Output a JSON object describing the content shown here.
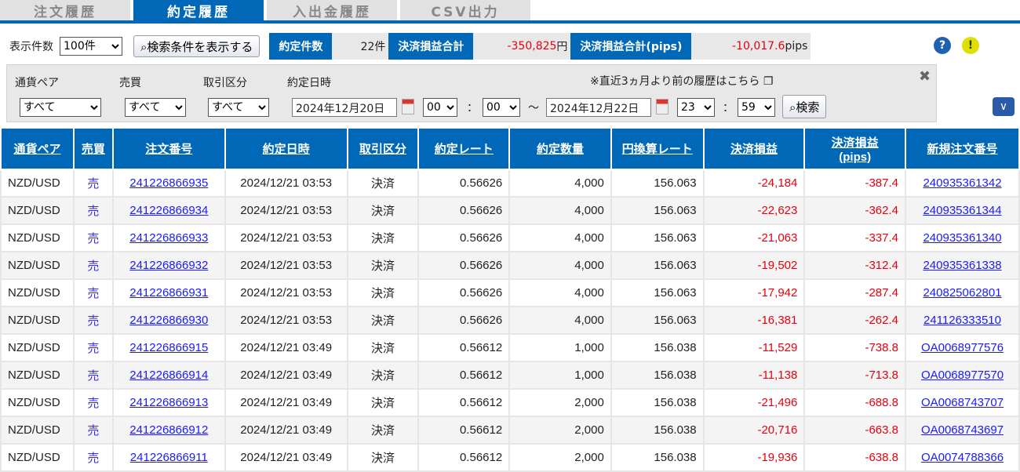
{
  "tabs": [
    "注文履歴",
    "約定履歴",
    "入出金履歴",
    "CSV出力"
  ],
  "summary": {
    "display_count_label": "表示件数",
    "display_count": "100件",
    "show_conditions": "検索条件を表示する",
    "count_label": "約定件数",
    "count": "22件",
    "pl_label": "決済損益合計",
    "pl_value": "-350,825",
    "pl_unit": "円",
    "pips_label": "決済損益合計(pips)",
    "pips_value": "-10,017.6",
    "pips_unit": "pips"
  },
  "filters": {
    "pair_label": "通貨ペア",
    "side_label": "売買",
    "type_label": "取引区分",
    "date_label": "約定日時",
    "pair": "すべて",
    "side": "すべて",
    "type": "すべて",
    "from_date": "2024年12月20日",
    "from_h": "00",
    "from_m": "00",
    "tilde": "～",
    "to_date": "2024年12月22日",
    "to_h": "23",
    "to_m": "59",
    "colon": "：",
    "search": "検索",
    "old_history": "※直近3ヵ月より前の履歴はこちら"
  },
  "headers": [
    "通貨ペア",
    "売買",
    "注文番号",
    "約定日時",
    "取引区分",
    "約定レート",
    "約定数量",
    "円換算レート",
    "決済損益",
    "決済損益\n(pips)",
    "新規注文番号"
  ],
  "rows": [
    [
      "NZD/USD",
      "売",
      "241226866935",
      "2024/12/21 03:53",
      "決済",
      "0.56626",
      "4,000",
      "156.063",
      "-24,184",
      "-387.4",
      "240935361342"
    ],
    [
      "NZD/USD",
      "売",
      "241226866934",
      "2024/12/21 03:53",
      "決済",
      "0.56626",
      "4,000",
      "156.063",
      "-22,623",
      "-362.4",
      "240935361344"
    ],
    [
      "NZD/USD",
      "売",
      "241226866933",
      "2024/12/21 03:53",
      "決済",
      "0.56626",
      "4,000",
      "156.063",
      "-21,063",
      "-337.4",
      "240935361340"
    ],
    [
      "NZD/USD",
      "売",
      "241226866932",
      "2024/12/21 03:53",
      "決済",
      "0.56626",
      "4,000",
      "156.063",
      "-19,502",
      "-312.4",
      "240935361338"
    ],
    [
      "NZD/USD",
      "売",
      "241226866931",
      "2024/12/21 03:53",
      "決済",
      "0.56626",
      "4,000",
      "156.063",
      "-17,942",
      "-287.4",
      "240825062801"
    ],
    [
      "NZD/USD",
      "売",
      "241226866930",
      "2024/12/21 03:53",
      "決済",
      "0.56626",
      "4,000",
      "156.063",
      "-16,381",
      "-262.4",
      "241126333510"
    ],
    [
      "NZD/USD",
      "売",
      "241226866915",
      "2024/12/21 03:49",
      "決済",
      "0.56612",
      "1,000",
      "156.038",
      "-11,529",
      "-738.8",
      "OA0068977576"
    ],
    [
      "NZD/USD",
      "売",
      "241226866914",
      "2024/12/21 03:49",
      "決済",
      "0.56612",
      "1,000",
      "156.038",
      "-11,138",
      "-713.8",
      "OA0068977570"
    ],
    [
      "NZD/USD",
      "売",
      "241226866913",
      "2024/12/21 03:49",
      "決済",
      "0.56612",
      "2,000",
      "156.038",
      "-21,496",
      "-688.8",
      "OA0068743707"
    ],
    [
      "NZD/USD",
      "売",
      "241226866912",
      "2024/12/21 03:49",
      "決済",
      "0.56612",
      "2,000",
      "156.038",
      "-20,716",
      "-663.8",
      "OA0068743697"
    ],
    [
      "NZD/USD",
      "売",
      "241226866911",
      "2024/12/21 03:49",
      "決済",
      "0.56612",
      "2,000",
      "156.038",
      "-19,936",
      "-638.8",
      "OA0074788366"
    ]
  ]
}
